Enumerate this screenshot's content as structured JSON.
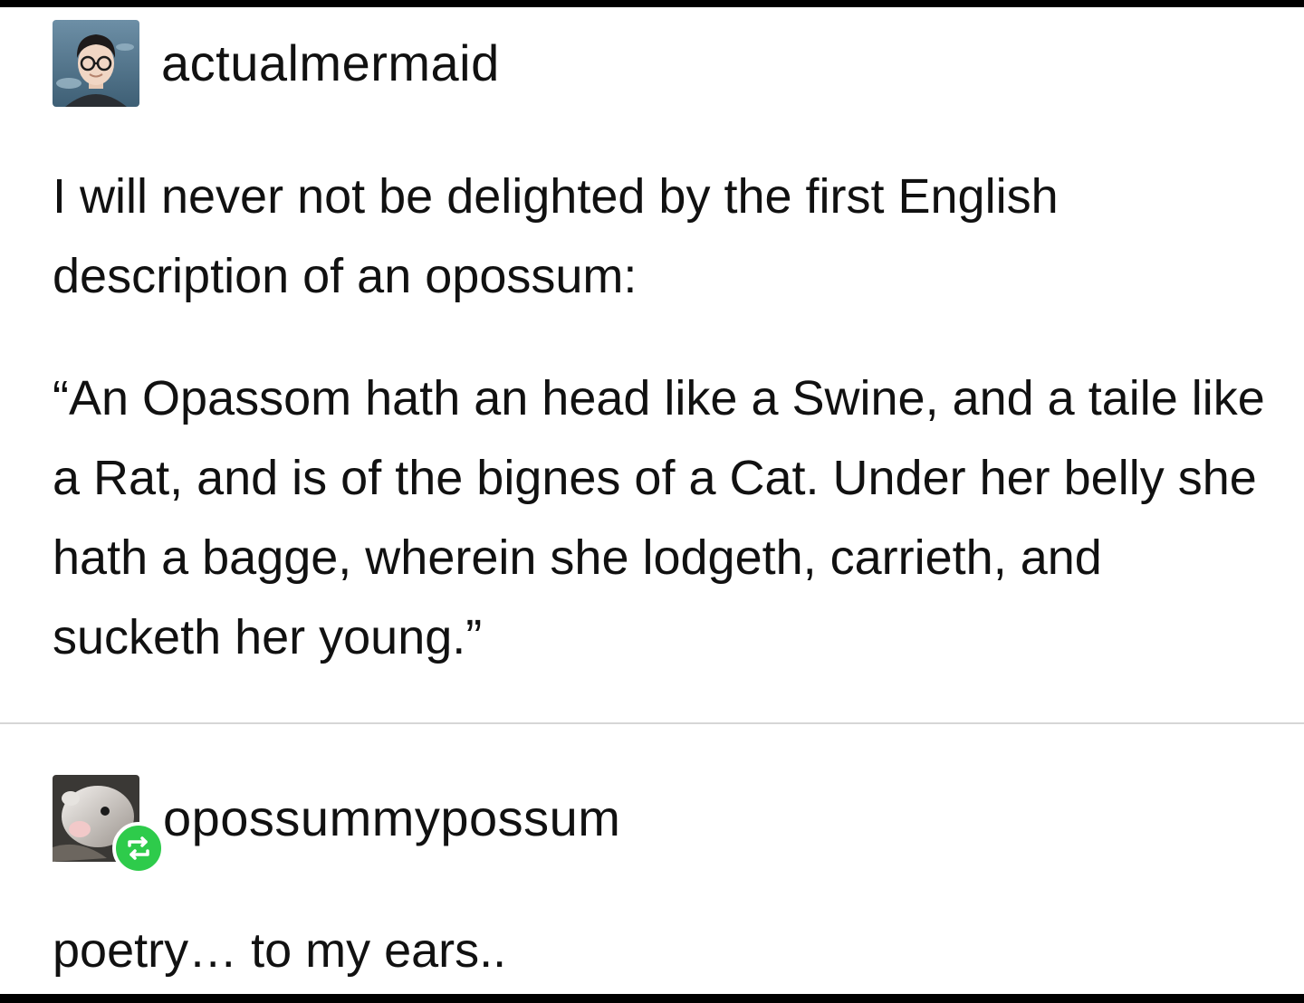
{
  "posts": [
    {
      "username": "actualmermaid",
      "avatar_icon": "avatar-person-glasses-icon",
      "paragraphs": [
        "I will never not be delighted by the first English description of an opossum:",
        "“An Opassom hath an head like a Swine, and a taile like a Rat, and is of the bignes of a Cat. Under her belly she hath a bagge, wherein she lodgeth, carrieth, and sucketh her young.”"
      ]
    },
    {
      "username": "opossummypossum",
      "avatar_icon": "avatar-opossum-icon",
      "badge_icon": "reblog-icon",
      "paragraphs": [
        "poetry… to my ears.."
      ]
    }
  ],
  "colors": {
    "background": "#ffffff",
    "frame": "#000000",
    "text": "#111111",
    "divider": "#d6d6d6",
    "reblog_badge": "#2ecb4b"
  }
}
